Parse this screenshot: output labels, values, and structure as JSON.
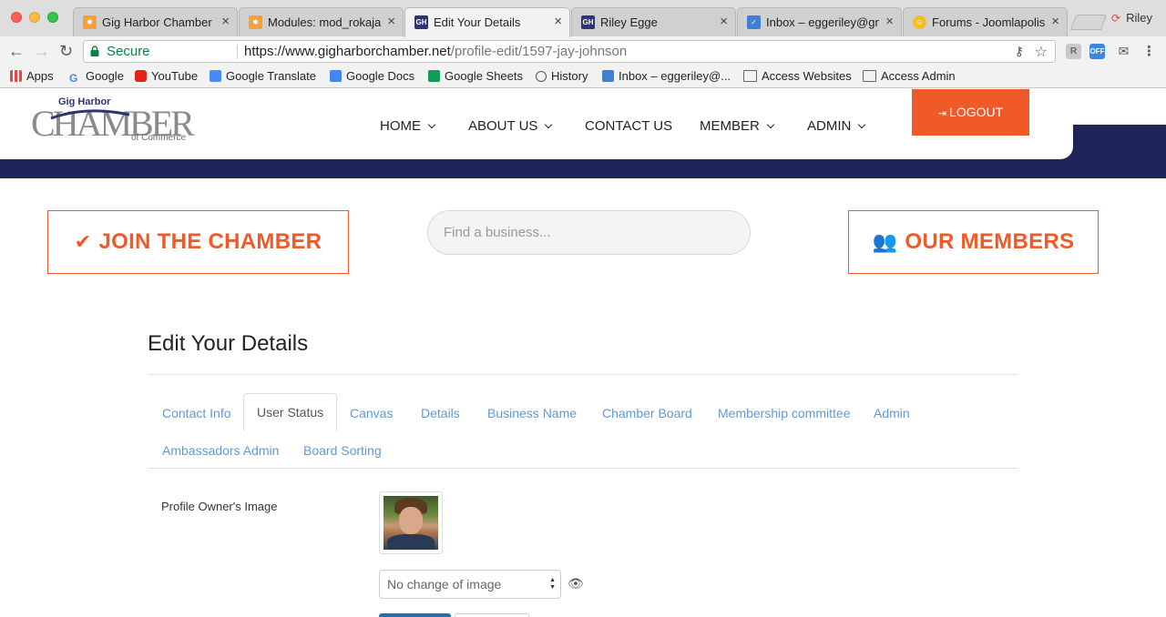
{
  "browser": {
    "tabs": [
      {
        "title": "Gig Harbor Chamber of",
        "icon": "joomla-icon"
      },
      {
        "title": "Modules: mod_rokajax",
        "icon": "joomla-icon"
      },
      {
        "title": "Edit Your Details",
        "icon": "chamber-icon",
        "active": true
      },
      {
        "title": "Riley Egge",
        "icon": "chamber-icon"
      },
      {
        "title": "Inbox – eggeriley@gm",
        "icon": "inbox-icon"
      },
      {
        "title": "Forums - Joomlapolis",
        "icon": "forum-icon"
      }
    ],
    "profile_name": "Riley",
    "secure_label": "Secure",
    "url_host": "https://www.gigharborchamber.net",
    "url_path": "/profile-edit/1597-jay-johnson",
    "extension_badge": "OFF",
    "bookmarks": [
      "Apps",
      "Google",
      "YouTube",
      "Google Translate",
      "Google Docs",
      "Google Sheets",
      "History",
      "Inbox – eggeriley@...",
      "Access Websites",
      "Access Admin"
    ]
  },
  "site": {
    "logo": {
      "line1": "Gig Harbor",
      "main": "CHAMBER",
      "line2": "of Commerce"
    },
    "nav": [
      {
        "label": "HOME",
        "dropdown": true
      },
      {
        "label": "ABOUT US",
        "dropdown": true
      },
      {
        "label": "CONTACT US",
        "dropdown": false
      },
      {
        "label": "MEMBER",
        "dropdown": true
      },
      {
        "label": "ADMIN",
        "dropdown": true
      }
    ],
    "logout_label": "LOGOUT",
    "join_label": "JOIN THE CHAMBER",
    "members_label": "OUR MEMBERS",
    "search_placeholder": "Find a business...",
    "accent_color": "#f05a28",
    "navy_color": "#1f2459"
  },
  "edit": {
    "title": "Edit Your Details",
    "tabs": [
      "Contact Info",
      "User Status",
      "Canvas",
      "Details",
      "Business Name",
      "Chamber Board",
      "Membership committee",
      "Admin",
      "Ambassadors Admin",
      "Board Sorting"
    ],
    "active_tab": "User Status",
    "image_label": "Profile Owner's Image",
    "image_select_value": "No change of image"
  }
}
